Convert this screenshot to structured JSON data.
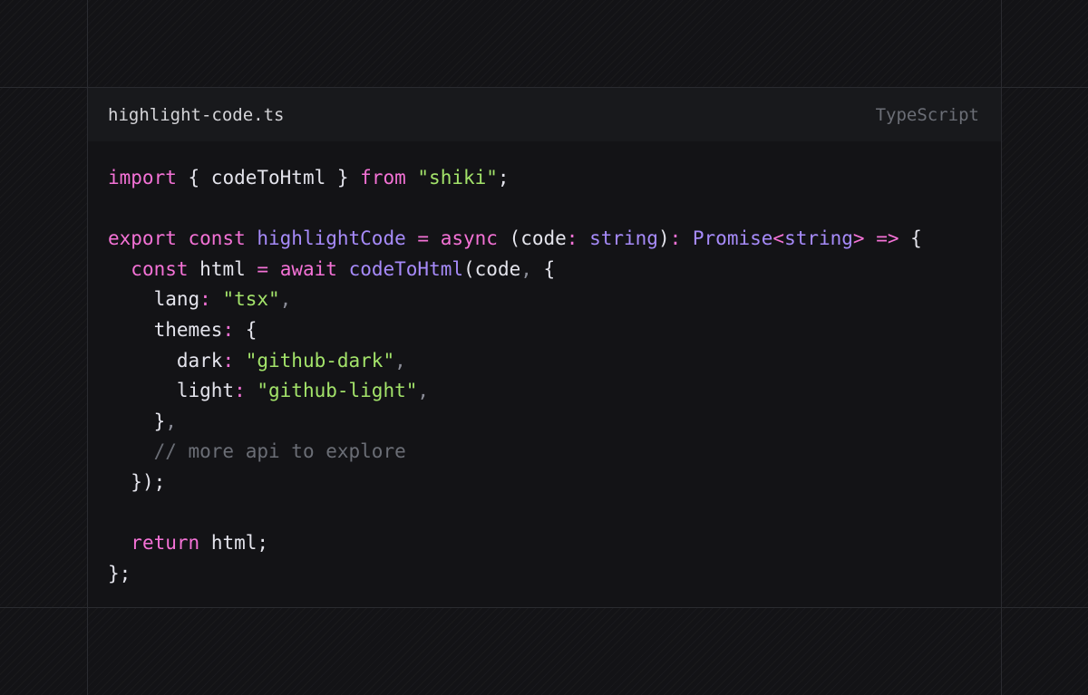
{
  "header": {
    "file_name": "highlight-code.ts",
    "language": "TypeScript"
  },
  "code": {
    "l1": {
      "import": "import",
      "brace_open": " { ",
      "name": "codeToHtml",
      "brace_close": " } ",
      "from": "from",
      "space": " ",
      "module": "\"shiki\"",
      "semi": ";"
    },
    "l3": {
      "export": "export",
      "const": " const ",
      "name": "highlightCode",
      "eq": " = ",
      "async": "async",
      "paren_open": " (",
      "param": "code",
      "colon": ": ",
      "ptype": "string",
      "paren_close": ")",
      "ret_colon": ": ",
      "promise": "Promise",
      "lt": "<",
      "gtype": "string",
      "gt": ">",
      "arrow": " => ",
      "brace": "{"
    },
    "l4": {
      "indent": "  ",
      "const": "const",
      "space": " ",
      "name": "html",
      "eq": " = ",
      "await": "await",
      "space2": " ",
      "fn": "codeToHtml",
      "open": "(",
      "arg": "code",
      "comma": ", ",
      "brace": "{"
    },
    "l5": {
      "indent": "    ",
      "key": "lang",
      "colon": ": ",
      "val": "\"tsx\"",
      "comma": ","
    },
    "l6": {
      "indent": "    ",
      "key": "themes",
      "colon": ": ",
      "brace": "{"
    },
    "l7": {
      "indent": "      ",
      "key": "dark",
      "colon": ": ",
      "val": "\"github-dark\"",
      "comma": ","
    },
    "l8": {
      "indent": "      ",
      "key": "light",
      "colon": ": ",
      "val": "\"github-light\"",
      "comma": ","
    },
    "l9": {
      "indent": "    ",
      "brace": "}",
      "comma": ","
    },
    "l10": {
      "indent": "    ",
      "comment": "// more api to explore"
    },
    "l11": {
      "indent": "  ",
      "close": "});"
    },
    "l13": {
      "indent": "  ",
      "return": "return",
      "space": " ",
      "name": "html",
      "semi": ";"
    },
    "l14": {
      "close": "};"
    }
  },
  "colors": {
    "background": "#131316",
    "header_background": "#18191c",
    "keyword": "#f472d6",
    "function": "#a78bfa",
    "string": "#a3e36a",
    "comment": "#6b6e76",
    "text": "#e4e4ec"
  }
}
